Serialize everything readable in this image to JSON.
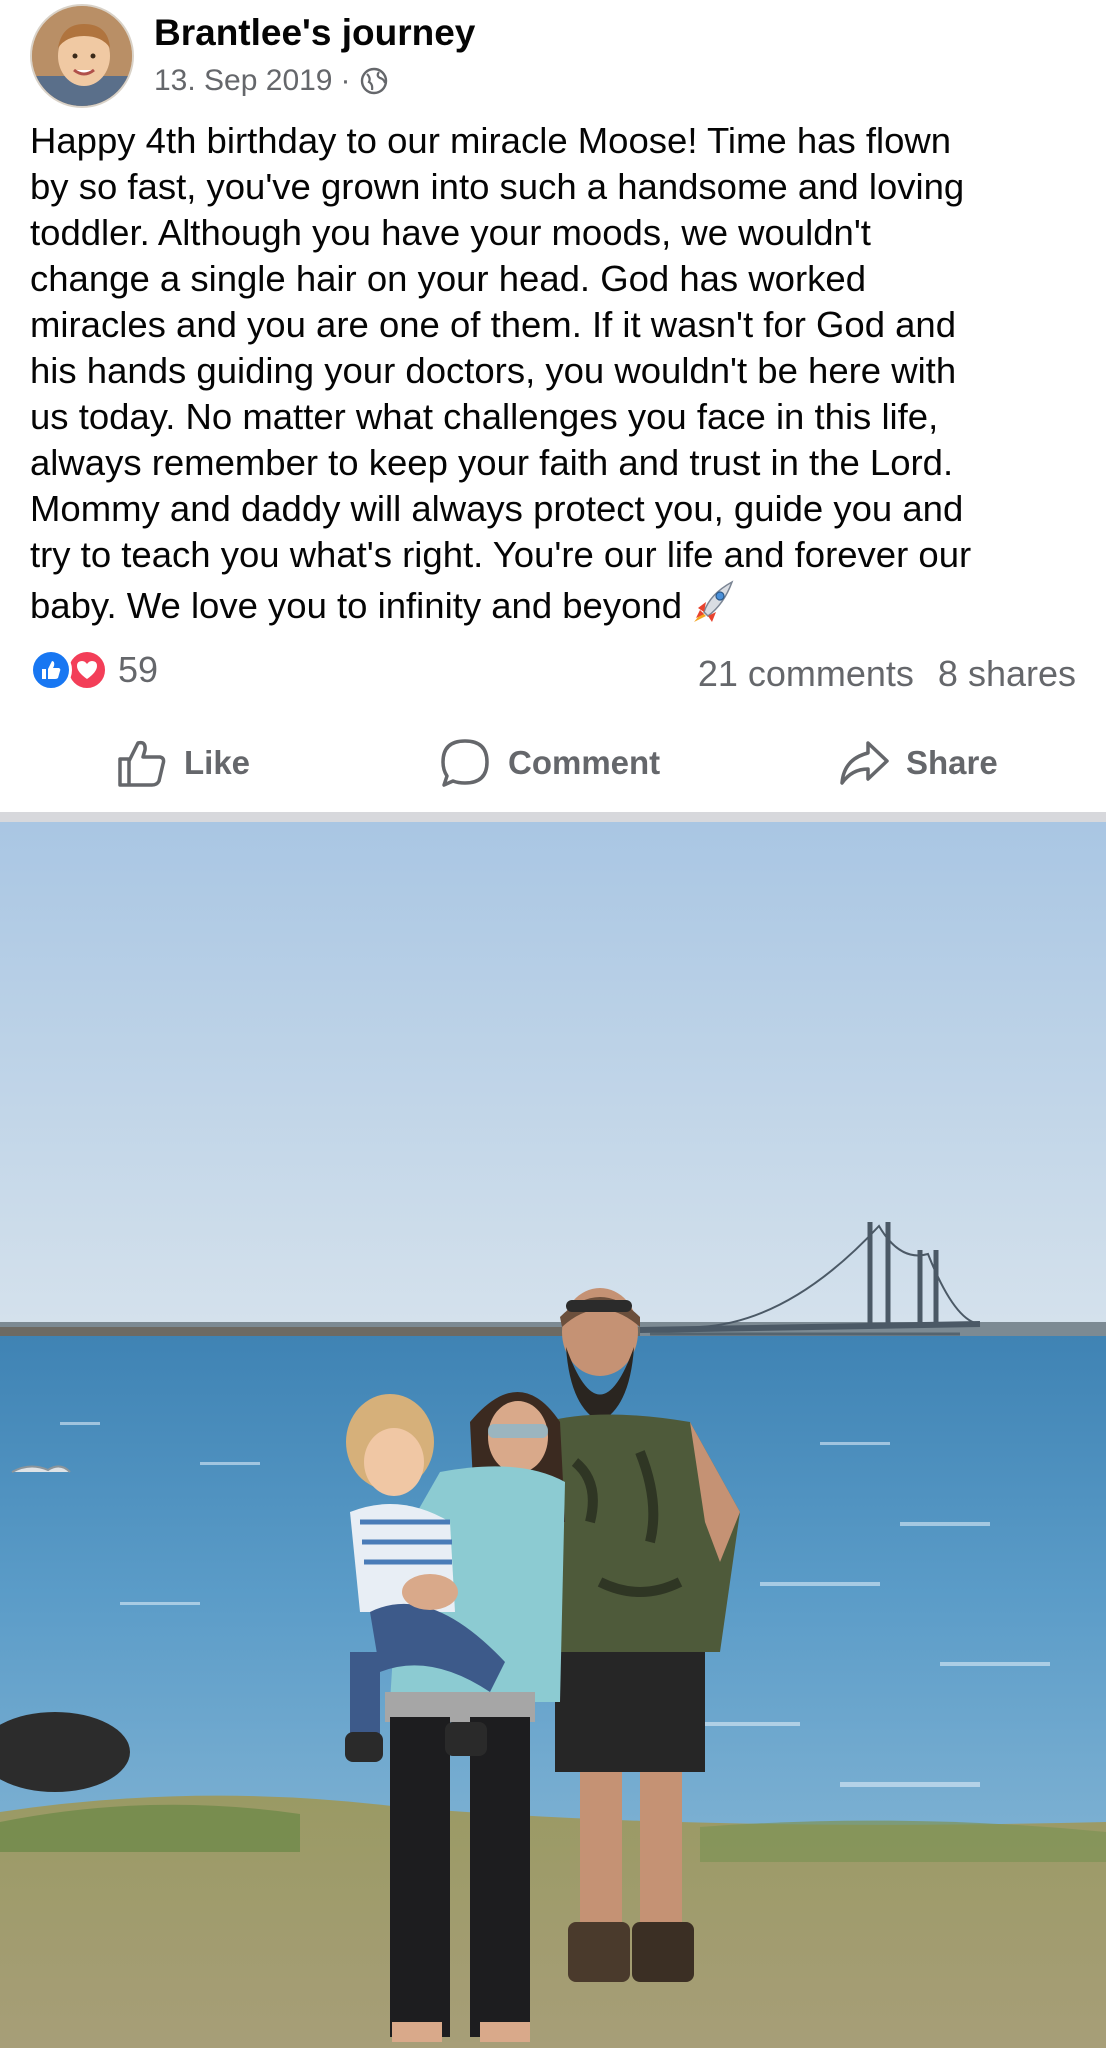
{
  "post": {
    "author": "Brantlee's journey",
    "date": "13. Sep 2019",
    "separator": "·",
    "privacy_icon": "globe-icon",
    "text_lines": [
      "Happy 4th birthday to our miracle Moose! Time has flown",
      "by so fast, you've grown into such a handsome and loving",
      "toddler. Although you have your moods, we wouldn't",
      "change a single hair on your head. God has worked",
      "miracles and you are one of them. If it wasn't for God and",
      "his hands guiding your doctors, you wouldn't be here with",
      "us today. No matter what challenges you face in this life,",
      "always remember to keep your faith and trust in the Lord.",
      "Mommy and daddy will always protect you, guide you and",
      "try to teach you what's right. You're our life and forever our",
      "baby. We love you to infinity and beyond"
    ],
    "text_emoji": "rocket-icon"
  },
  "stats": {
    "reaction_count": "59",
    "comments": "21 comments",
    "shares": "8 shares"
  },
  "actions": {
    "like": "Like",
    "comment": "Comment",
    "share": "Share"
  },
  "colors": {
    "like_blue": "#1877f2",
    "love_red": "#f33e58",
    "secondary_text": "#65676b",
    "divider": "#d7d8dc"
  }
}
